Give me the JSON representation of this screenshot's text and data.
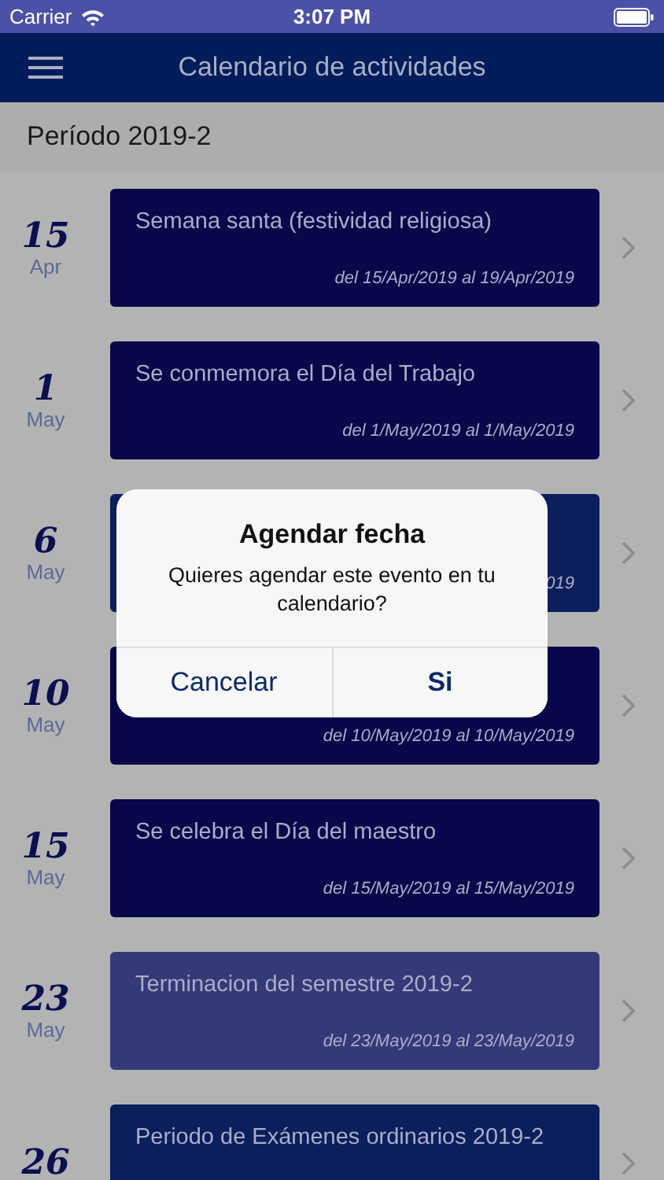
{
  "status_bar": {
    "carrier": "Carrier",
    "time": "3:07 PM"
  },
  "nav": {
    "title": "Calendario de actividades"
  },
  "period": "Período 2019-2",
  "events": [
    {
      "day": "15",
      "month": "Apr",
      "title": "Semana santa (festividad religiosa)",
      "range": "del 15/Apr/2019 al 19/Apr/2019",
      "color": "#07074a"
    },
    {
      "day": "1",
      "month": "May",
      "title": "Se conmemora el Día del Trabajo",
      "range": "del 1/May/2019 al 1/May/2019",
      "color": "#07074a"
    },
    {
      "day": "6",
      "month": "May",
      "range": "019",
      "color": "#0b1f5c"
    },
    {
      "day": "10",
      "month": "May",
      "range": "del 10/May/2019 al 10/May/2019",
      "color": "#07074a"
    },
    {
      "day": "15",
      "month": "May",
      "title": "Se celebra el Día del maestro",
      "range": "del 15/May/2019 al 15/May/2019",
      "color": "#07074a"
    },
    {
      "day": "23",
      "month": "May",
      "title": "Terminacion del semestre 2019-2",
      "range": "del 23/May/2019 al 23/May/2019",
      "color": "#343a78"
    },
    {
      "day": "26",
      "title": "Periodo de Exámenes ordinarios 2019-2",
      "color": "#0b1f5c"
    }
  ],
  "alert": {
    "title": "Agendar fecha",
    "message": "Quieres agendar este evento en tu calendario?",
    "buttons": [
      {
        "label": "Cancelar",
        "kind": "cancel"
      },
      {
        "label": "Si",
        "kind": "default"
      }
    ]
  }
}
